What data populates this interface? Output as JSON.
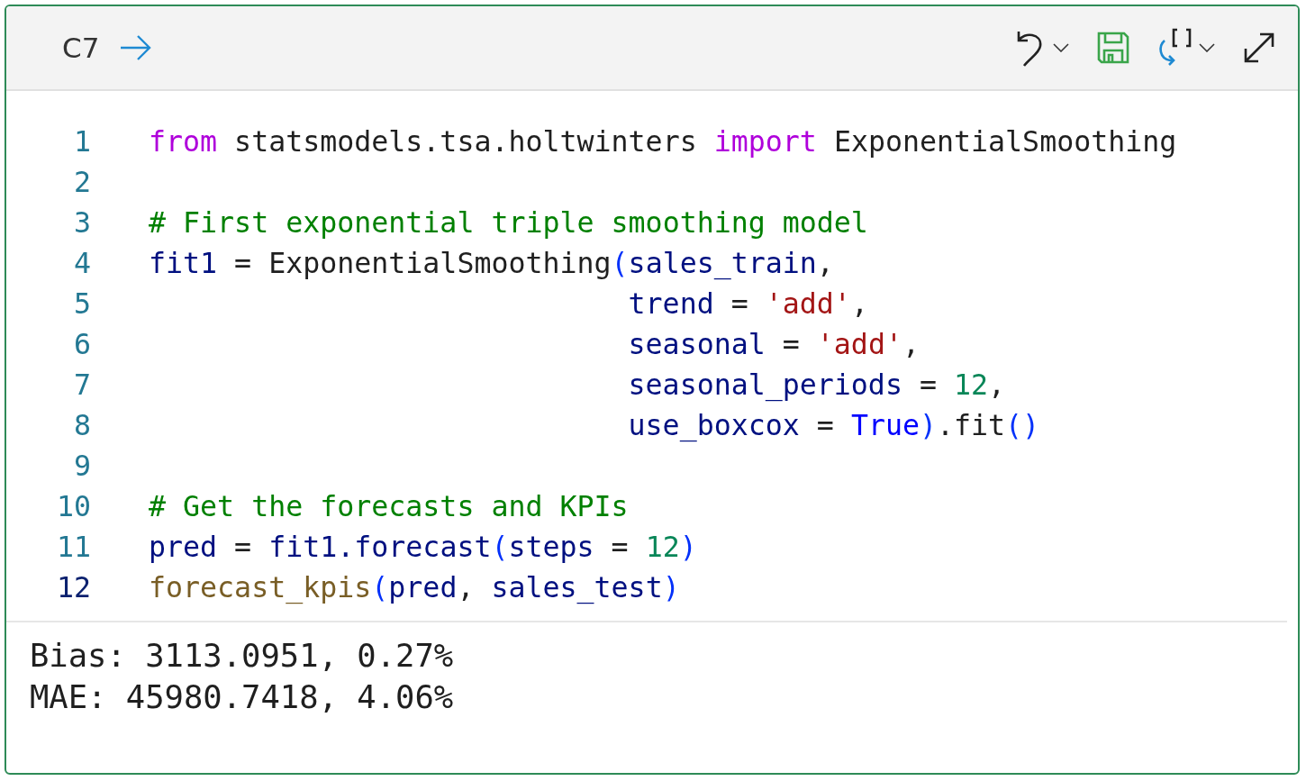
{
  "cell": {
    "label": "C7"
  },
  "code_lines": [
    {
      "number": "1",
      "current": false,
      "indented": false,
      "tokens": [
        {
          "text": "from",
          "kind": "keyword"
        },
        {
          "text": " statsmodels.tsa.holtwinters ",
          "kind": "plain"
        },
        {
          "text": "import",
          "kind": "keyword"
        },
        {
          "text": " ExponentialSmoothing",
          "kind": "plain"
        }
      ]
    },
    {
      "number": "2",
      "current": false,
      "indented": false
    },
    {
      "number": "3",
      "current": false,
      "indented": false,
      "tokens": [
        {
          "text": "# First exponential triple smoothing model",
          "kind": "comment"
        }
      ]
    },
    {
      "number": "4",
      "current": false,
      "indented": false,
      "tokens": [
        {
          "text": "fit1",
          "kind": "variable"
        },
        {
          "text": " = ExponentialSmoothing",
          "kind": "plain"
        },
        {
          "text": "(",
          "kind": "bracket"
        },
        {
          "text": "sales_train",
          "kind": "variable"
        },
        {
          "text": ",",
          "kind": "plain"
        }
      ]
    },
    {
      "number": "5",
      "current": false,
      "indented": true,
      "tokens": [
        {
          "text": "trend",
          "kind": "variable"
        },
        {
          "text": " = ",
          "kind": "plain"
        },
        {
          "text": "'add'",
          "kind": "string"
        },
        {
          "text": ",",
          "kind": "plain"
        }
      ]
    },
    {
      "number": "6",
      "current": false,
      "indented": true,
      "tokens": [
        {
          "text": "seasonal",
          "kind": "variable"
        },
        {
          "text": " = ",
          "kind": "plain"
        },
        {
          "text": "'add'",
          "kind": "string"
        },
        {
          "text": ",",
          "kind": "plain"
        }
      ]
    },
    {
      "number": "7",
      "current": false,
      "indented": true,
      "tokens": [
        {
          "text": "seasonal_periods",
          "kind": "variable"
        },
        {
          "text": " = ",
          "kind": "plain"
        },
        {
          "text": "12",
          "kind": "number"
        },
        {
          "text": ",",
          "kind": "plain"
        }
      ]
    },
    {
      "number": "8",
      "current": false,
      "indented": true,
      "tokens": [
        {
          "text": "use_boxcox",
          "kind": "variable"
        },
        {
          "text": " = ",
          "kind": "plain"
        },
        {
          "text": "True",
          "kind": "constant"
        },
        {
          "text": ")",
          "kind": "bracket"
        },
        {
          "text": ".fit",
          "kind": "plain"
        },
        {
          "text": "()",
          "kind": "bracket"
        }
      ]
    },
    {
      "number": "9",
      "current": false,
      "indented": false
    },
    {
      "number": "10",
      "current": false,
      "indented": false,
      "tokens": [
        {
          "text": "# Get the forecasts and KPIs",
          "kind": "comment"
        }
      ]
    },
    {
      "number": "11",
      "current": false,
      "indented": false,
      "tokens": [
        {
          "text": "pred",
          "kind": "variable"
        },
        {
          "text": " = ",
          "kind": "plain"
        },
        {
          "text": "fit1.forecast",
          "kind": "variable"
        },
        {
          "text": "(",
          "kind": "bracket"
        },
        {
          "text": "steps",
          "kind": "variable"
        },
        {
          "text": " = ",
          "kind": "plain"
        },
        {
          "text": "12",
          "kind": "number"
        },
        {
          "text": ")",
          "kind": "bracket"
        }
      ]
    },
    {
      "number": "12",
      "current": true,
      "indented": false,
      "tokens": [
        {
          "text": "forecast_kpis",
          "kind": "function"
        },
        {
          "text": "(",
          "kind": "bracket"
        },
        {
          "text": "pred",
          "kind": "variable"
        },
        {
          "text": ", ",
          "kind": "plain"
        },
        {
          "text": "sales_test",
          "kind": "variable"
        },
        {
          "text": ")",
          "kind": "bracket"
        }
      ]
    }
  ],
  "output_lines": [
    "Bias: 3113.0951, 0.27%",
    "MAE: 45980.7418, 4.06%"
  ]
}
